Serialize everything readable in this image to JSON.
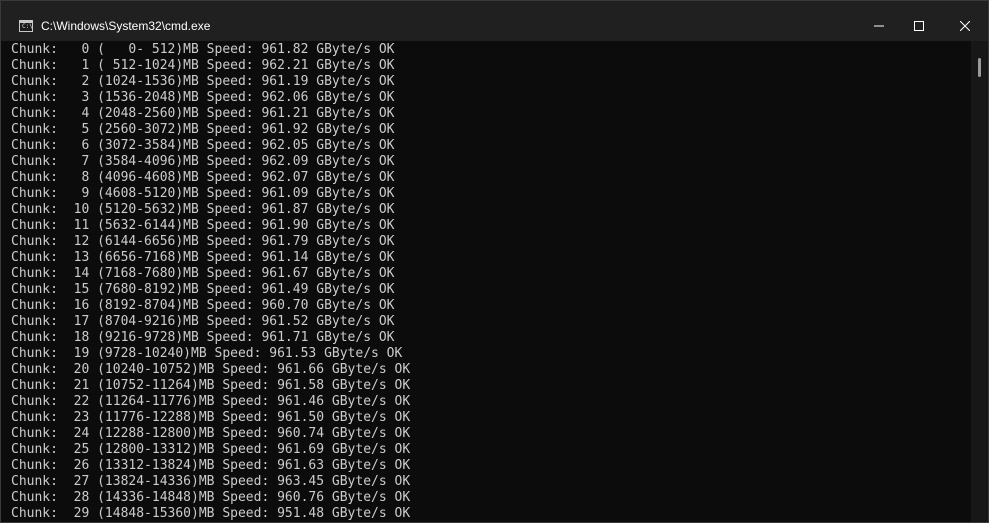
{
  "window": {
    "title": "C:\\Windows\\System32\\cmd.exe",
    "icon": "cmd-console-icon"
  },
  "controls": {
    "minimize": "minimize-icon",
    "maximize": "maximize-icon",
    "close": "close-icon"
  },
  "console": {
    "lines": [
      "Chunk:   0 (   0- 512)MB Speed: 961.82 GByte/s OK",
      "Chunk:   1 ( 512-1024)MB Speed: 962.21 GByte/s OK",
      "Chunk:   2 (1024-1536)MB Speed: 961.19 GByte/s OK",
      "Chunk:   3 (1536-2048)MB Speed: 962.06 GByte/s OK",
      "Chunk:   4 (2048-2560)MB Speed: 961.21 GByte/s OK",
      "Chunk:   5 (2560-3072)MB Speed: 961.92 GByte/s OK",
      "Chunk:   6 (3072-3584)MB Speed: 962.05 GByte/s OK",
      "Chunk:   7 (3584-4096)MB Speed: 962.09 GByte/s OK",
      "Chunk:   8 (4096-4608)MB Speed: 962.07 GByte/s OK",
      "Chunk:   9 (4608-5120)MB Speed: 961.09 GByte/s OK",
      "Chunk:  10 (5120-5632)MB Speed: 961.87 GByte/s OK",
      "Chunk:  11 (5632-6144)MB Speed: 961.90 GByte/s OK",
      "Chunk:  12 (6144-6656)MB Speed: 961.79 GByte/s OK",
      "Chunk:  13 (6656-7168)MB Speed: 961.14 GByte/s OK",
      "Chunk:  14 (7168-7680)MB Speed: 961.67 GByte/s OK",
      "Chunk:  15 (7680-8192)MB Speed: 961.49 GByte/s OK",
      "Chunk:  16 (8192-8704)MB Speed: 960.70 GByte/s OK",
      "Chunk:  17 (8704-9216)MB Speed: 961.52 GByte/s OK",
      "Chunk:  18 (9216-9728)MB Speed: 961.71 GByte/s OK",
      "Chunk:  19 (9728-10240)MB Speed: 961.53 GByte/s OK",
      "Chunk:  20 (10240-10752)MB Speed: 961.66 GByte/s OK",
      "Chunk:  21 (10752-11264)MB Speed: 961.58 GByte/s OK",
      "Chunk:  22 (11264-11776)MB Speed: 961.46 GByte/s OK",
      "Chunk:  23 (11776-12288)MB Speed: 961.50 GByte/s OK",
      "Chunk:  24 (12288-12800)MB Speed: 960.74 GByte/s OK",
      "Chunk:  25 (12800-13312)MB Speed: 961.69 GByte/s OK",
      "Chunk:  26 (13312-13824)MB Speed: 961.63 GByte/s OK",
      "Chunk:  27 (13824-14336)MB Speed: 963.45 GByte/s OK",
      "Chunk:  28 (14336-14848)MB Speed: 960.76 GByte/s OK",
      "Chunk:  29 (14848-15360)MB Speed: 951.48 GByte/s OK"
    ]
  },
  "colors": {
    "console_bg": "#0c0c0c",
    "titlebar_bg": "#202020",
    "text": "#cccccc"
  }
}
